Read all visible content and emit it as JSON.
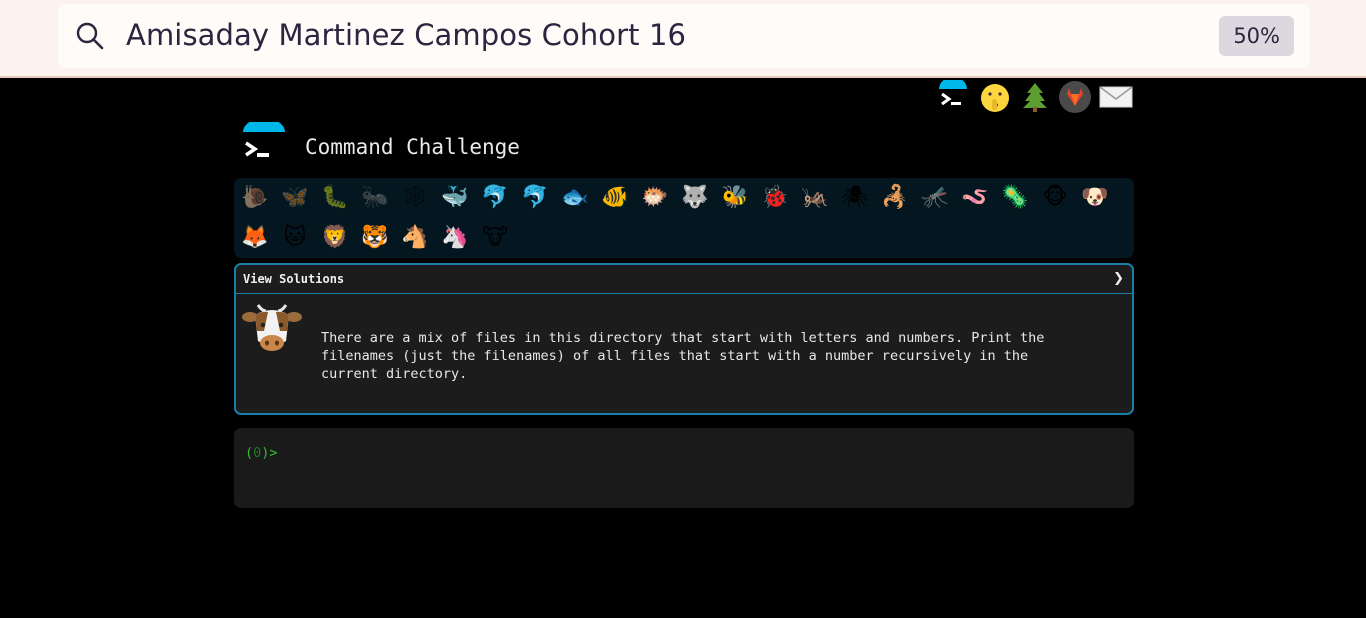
{
  "search": {
    "query": "Amisaday Martinez Campos Cohort 16",
    "zoom": "50%"
  },
  "header": {
    "icons": [
      "terminal-logo-icon",
      "shushing-face-icon",
      "evergreen-tree-icon",
      "gitlab-icon",
      "envelope-icon"
    ]
  },
  "site": {
    "title": "Command Challenge"
  },
  "animals": {
    "row1": [
      "🐌",
      "🦋",
      "🐛",
      "🐜",
      "🕸",
      "🐳",
      "🐬",
      "🐬",
      "🐟",
      "🐠",
      "🐡",
      "🐺",
      "🐝",
      "🐞",
      "🦗",
      "🕷",
      "🦂",
      "🦟",
      "🪱",
      "🦠",
      "🐵",
      "🐶"
    ],
    "row2": [
      "🦊",
      "🐱",
      "🦁",
      "🐯",
      "🐴",
      "🦄",
      "🐮"
    ]
  },
  "challenge": {
    "view_solutions": "View Solutions",
    "chevron": "❯",
    "description": "There are a mix of files in this directory that start with letters and numbers. Print the\nfilenames (just the filenames) of all files that start with a number recursively in the\ncurrent directory."
  },
  "terminal": {
    "prompt_open": "(",
    "prompt_num": "0",
    "prompt_close": ")>"
  },
  "colors": {
    "accent": "#1b7ea8",
    "prompt_green": "#2fbf3a",
    "logo_blue": "#00b7ea"
  }
}
